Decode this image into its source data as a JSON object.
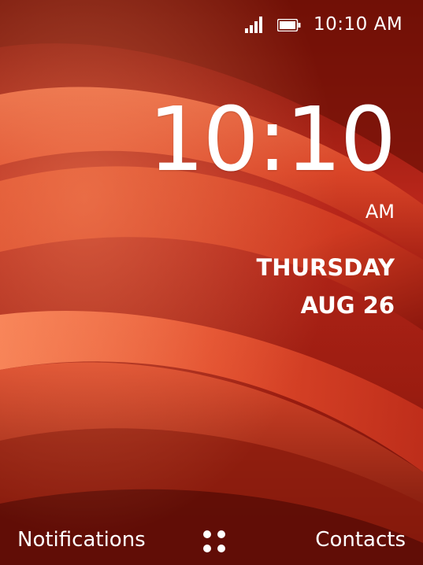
{
  "status_bar": {
    "time": "10:10 AM",
    "signal_icon": "signal-strength-icon",
    "battery_icon": "battery-icon"
  },
  "lockscreen": {
    "time": "10:10",
    "ampm": "AM",
    "day": "THURSDAY",
    "date": "AUG 26"
  },
  "softkeys": {
    "left": "Notifications",
    "center_icon": "apps-grid-icon",
    "right": "Contacts"
  },
  "colors": {
    "wallpaper_dark": "#5a0c06",
    "wallpaper_mid": "#c8321a",
    "wallpaper_light": "#f07048",
    "text": "#ffffff"
  }
}
